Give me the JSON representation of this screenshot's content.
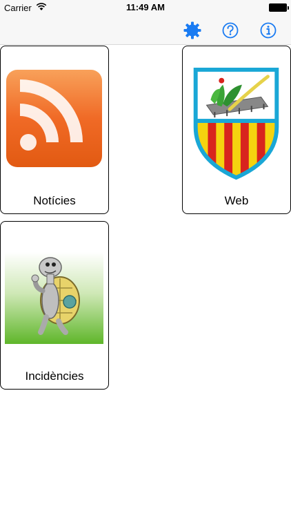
{
  "status_bar": {
    "carrier": "Carrier",
    "time": "11:49 AM"
  },
  "toolbar": {
    "accent_color": "#1a7bf2",
    "items": [
      {
        "icon": "gear-icon"
      },
      {
        "icon": "help-icon"
      },
      {
        "icon": "info-icon"
      }
    ]
  },
  "tiles": [
    {
      "label": "Notícies",
      "icon": "rss-icon"
    },
    {
      "label": "Web",
      "icon": "crest-icon"
    },
    {
      "label": "Incidències",
      "icon": "turtle-icon"
    }
  ]
}
